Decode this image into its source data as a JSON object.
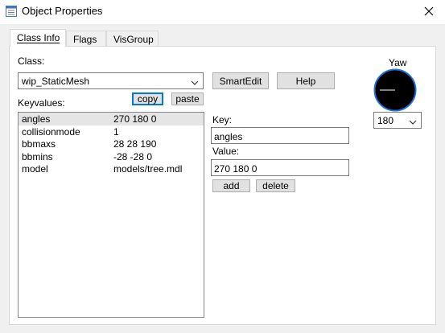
{
  "window": {
    "title": "Object Properties",
    "icon": "properties-window-icon",
    "close_icon": "close-icon"
  },
  "tabs": [
    {
      "label": "Class Info",
      "active": true
    },
    {
      "label": "Flags",
      "active": false
    },
    {
      "label": "VisGroup",
      "active": false
    }
  ],
  "class_section": {
    "label": "Class:",
    "selected": "wip_StaticMesh",
    "smartedit_label": "SmartEdit",
    "help_label": "Help"
  },
  "keyvalues": {
    "label": "Keyvalues:",
    "copy_label": "copy",
    "paste_label": "paste",
    "rows": [
      {
        "key": "angles",
        "value": "270 180 0",
        "selected": true
      },
      {
        "key": "collisionmode",
        "value": "1",
        "selected": false
      },
      {
        "key": "bbmaxs",
        "value": "28 28 190",
        "selected": false
      },
      {
        "key": "bbmins",
        "value": "-28 -28 0",
        "selected": false
      },
      {
        "key": "model",
        "value": "models/tree.mdl",
        "selected": false
      }
    ]
  },
  "editor": {
    "key_label": "Key:",
    "key_value": "angles",
    "value_label": "Value:",
    "value_value": "270 180 0",
    "add_label": "add",
    "delete_label": "delete"
  },
  "yaw": {
    "label": "Yaw",
    "selected": "180",
    "dial_color": "#000000",
    "ring_color": "#1e6fd9"
  }
}
